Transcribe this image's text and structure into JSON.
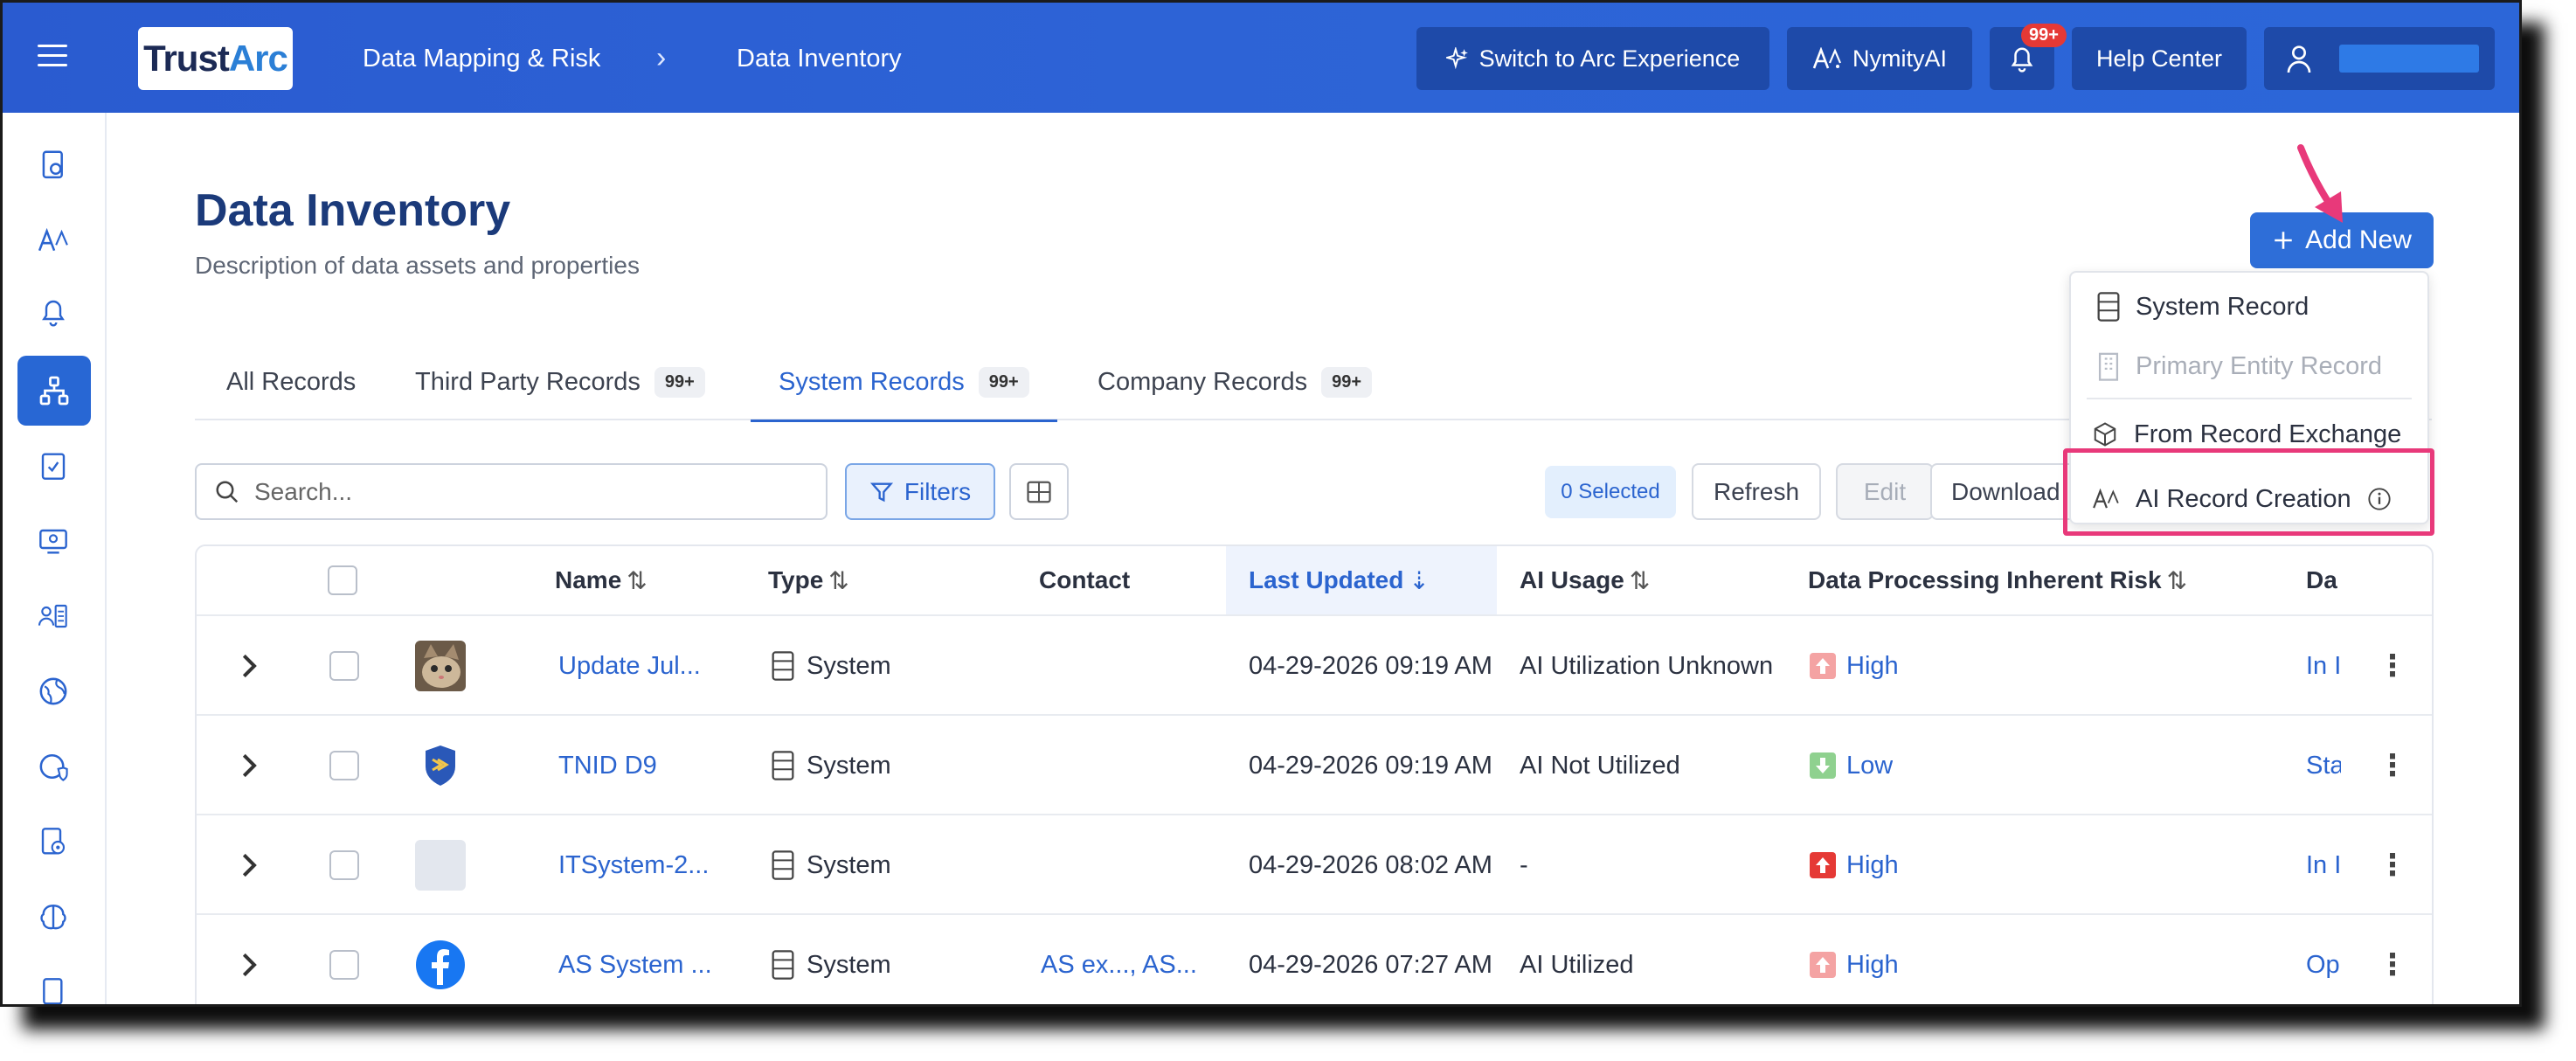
{
  "header": {
    "logo_text": "TrustArc",
    "breadcrumb": [
      "Data Mapping & Risk",
      "Data Inventory"
    ],
    "switch_label": "Switch to Arc Experience",
    "nymity_label": "NymityAI",
    "notif_count": "99+",
    "help_label": "Help Center"
  },
  "sidebar": {
    "icons": [
      "dashboard-icon",
      "nymity-ai-icon",
      "notifications-icon",
      "data-mapping-icon",
      "assessments-icon",
      "monitor-icon",
      "people-list-icon",
      "globe-privacy-icon",
      "globe-shield-icon",
      "document-settings-icon",
      "brain-icon",
      "document-icon"
    ],
    "active_index": 3
  },
  "page": {
    "title": "Data Inventory",
    "subtitle": "Description of data assets and properties"
  },
  "tabs": [
    {
      "label": "All Records",
      "count": ""
    },
    {
      "label": "Third Party Records",
      "count": "99+"
    },
    {
      "label": "System Records",
      "count": "99+"
    },
    {
      "label": "Company Records",
      "count": "99+"
    }
  ],
  "active_tab": 2,
  "toolbar": {
    "search_placeholder": "Search...",
    "filters_label": "Filters",
    "selected_label": "0 Selected",
    "refresh_label": "Refresh",
    "edit_label": "Edit",
    "download_label": "Download"
  },
  "add_new": {
    "label": "Add New",
    "menu": {
      "system_record": "System Record",
      "primary_entity_record": "Primary Entity Record",
      "from_record_exchange": "From Record Exchange",
      "ai_record_creation": "AI Record Creation"
    }
  },
  "table": {
    "columns": {
      "name": "Name",
      "type": "Type",
      "contact": "Contact",
      "last_updated": "Last Updated",
      "ai_usage": "AI Usage",
      "risk": "Data Processing Inherent Risk",
      "more": "Da"
    },
    "rows": [
      {
        "name": "Update Jul...",
        "type": "System",
        "contact": "",
        "updated": "04-29-2026 09:19 AM",
        "ai_usage": "AI Utilization Unknown",
        "risk": "High",
        "status": "In I",
        "avatar": "cat"
      },
      {
        "name": "TNID D9",
        "type": "System",
        "contact": "",
        "updated": "04-29-2026 09:19 AM",
        "ai_usage": "AI Not Utilized",
        "risk": "Low",
        "status": "Sta",
        "avatar": "shield"
      },
      {
        "name": "ITSystem-2...",
        "type": "System",
        "contact": "",
        "updated": "04-29-2026 08:02 AM",
        "ai_usage": "-",
        "risk": "High",
        "status": "In I",
        "avatar": "blank"
      },
      {
        "name": "AS System ...",
        "type": "System",
        "contact": "AS ex..., AS...",
        "updated": "04-29-2026 07:27 AM",
        "ai_usage": "AI Utilized",
        "risk": "High",
        "status": "Op",
        "avatar": "facebook"
      }
    ]
  },
  "colors": {
    "header_blue": "#2c63d6",
    "accent": "#2b64cf",
    "highlight_pink": "#e8397a",
    "risk_high": "#e53935",
    "risk_low": "#4caf50"
  }
}
